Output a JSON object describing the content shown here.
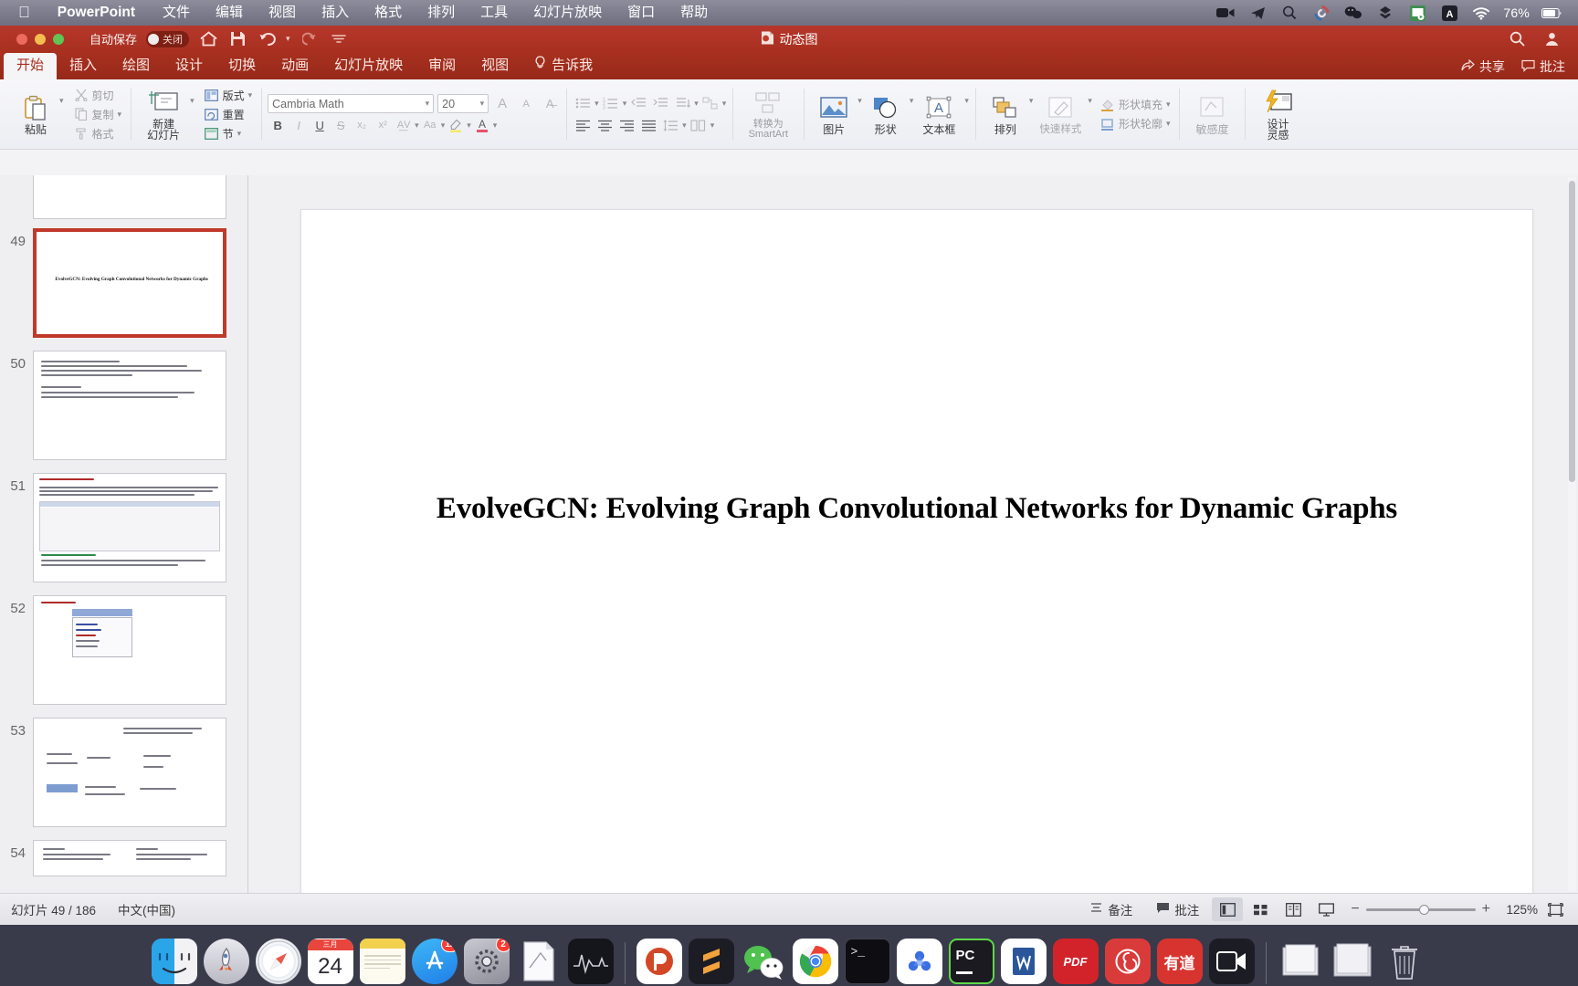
{
  "menubar": {
    "apple": "apple-logo",
    "app_name": "PowerPoint",
    "items": [
      "文件",
      "编辑",
      "视图",
      "插入",
      "格式",
      "排列",
      "工具",
      "幻灯片放映",
      "窗口",
      "帮助"
    ],
    "status_icons": [
      "camera-icon",
      "telegram-icon",
      "alfred-icon",
      "sync-icon",
      "wechat-icon",
      "dropbox-icon",
      "powerpoint-status-icon",
      "abc-input-icon"
    ],
    "wifi_icon": "wifi-icon",
    "battery_percent": "76%",
    "battery_icon": "battery-icon",
    "right_icons": [
      "clock-icon",
      "search-icon",
      "siri-icon",
      "control-center-icon"
    ]
  },
  "titlebar": {
    "autosave_label": "自动保存",
    "autosave_state": "关闭",
    "icons": [
      "home-icon",
      "save-icon",
      "undo-icon",
      "redo-icon",
      "customize-icon"
    ],
    "document_title": "动态图",
    "doc_icon": "powerpoint-doc-icon",
    "search_icon": "search-icon",
    "account_icon": "account-icon"
  },
  "ribbon": {
    "tabs": [
      {
        "label": "开始",
        "active": true
      },
      {
        "label": "插入",
        "active": false
      },
      {
        "label": "绘图",
        "active": false
      },
      {
        "label": "设计",
        "active": false
      },
      {
        "label": "切换",
        "active": false
      },
      {
        "label": "动画",
        "active": false
      },
      {
        "label": "幻灯片放映",
        "active": false
      },
      {
        "label": "审阅",
        "active": false
      },
      {
        "label": "视图",
        "active": false
      }
    ],
    "tellme_label": "告诉我",
    "share_label": "共享",
    "comments_label": "批注",
    "groups": {
      "clipboard": {
        "paste": "粘贴",
        "cut": "剪切",
        "copy": "复制",
        "format_painter": "格式"
      },
      "slides": {
        "new_slide": "新建\n幻灯片",
        "new_slide_line1": "新建",
        "new_slide_line2": "幻灯片",
        "layout": "版式",
        "reset": "重置",
        "section": "节"
      },
      "font": {
        "font_name": "Cambria Math",
        "font_size": "20",
        "grow_font": "A",
        "shrink_font": "A",
        "clear_formatting": "A",
        "bold": "B",
        "italic": "I",
        "underline": "U",
        "strikethrough": "S",
        "shadow": "S",
        "subscript": "x₂",
        "superscript": "x²",
        "char_spacing": "AV",
        "change_case": "Aa",
        "highlight": "highlight-icon",
        "font_color": "A"
      },
      "drawing": {
        "pictures": "图片",
        "shapes": "形状",
        "textbox": "文本框",
        "arrange": "排列",
        "quick_styles": "快速样式",
        "shape_fill": "形状填充",
        "shape_outline": "形状轮廓"
      },
      "sensitivity": {
        "label": "敏感度"
      },
      "designer": {
        "line1": "设计",
        "line2": "灵感"
      }
    }
  },
  "thumbnails": [
    {
      "number": "48",
      "selected": false,
      "kind": "blank",
      "title": ""
    },
    {
      "number": "49",
      "selected": true,
      "kind": "title",
      "title": "EvolveGCN: Evolving Graph Convolutional Networks for Dynamic Graphs"
    },
    {
      "number": "50",
      "selected": false,
      "kind": "text",
      "title": ""
    },
    {
      "number": "51",
      "selected": false,
      "kind": "table",
      "title": ""
    },
    {
      "number": "52",
      "selected": false,
      "kind": "small-table",
      "title": ""
    },
    {
      "number": "53",
      "selected": false,
      "kind": "diagram",
      "title": ""
    },
    {
      "number": "54",
      "selected": false,
      "kind": "two-col",
      "title": ""
    }
  ],
  "slide": {
    "title": "EvolveGCN: Evolving Graph Convolutional Networks for Dynamic Graphs"
  },
  "statusbar": {
    "slide_counter": "幻灯片 49 / 186",
    "language": "中文(中国)",
    "notes_label": "备注",
    "comments_label": "批注",
    "views": [
      "normal-view-icon",
      "slide-sorter-icon",
      "reading-view-icon",
      "slideshow-icon"
    ],
    "zoom_minus": "−",
    "zoom_plus": "+",
    "zoom_percent": "125%",
    "fit_icon": "fit-to-window-icon"
  },
  "dock": {
    "items": [
      {
        "name": "finder-icon",
        "label": "Finder",
        "badge": "",
        "running": true
      },
      {
        "name": "launchpad-icon",
        "label": "Launchpad",
        "badge": "",
        "running": false
      },
      {
        "name": "safari-icon",
        "label": "Safari",
        "badge": "",
        "running": false
      },
      {
        "name": "calendar-icon",
        "label": "Calendar",
        "badge": "",
        "day": "24",
        "month": "三月",
        "running": false
      },
      {
        "name": "notes-icon",
        "label": "Notes",
        "badge": "",
        "running": false
      },
      {
        "name": "app-store-icon",
        "label": "App Store",
        "badge": "12",
        "running": false
      },
      {
        "name": "system-preferences-icon",
        "label": "System Preferences",
        "badge": "2",
        "running": false
      },
      {
        "name": "preview-icon",
        "label": "Preview",
        "badge": "",
        "running": false
      },
      {
        "name": "activity-monitor-icon",
        "label": "Activity Monitor",
        "badge": "",
        "running": false
      },
      {
        "name": "powerpoint-icon",
        "label": "PowerPoint",
        "badge": "",
        "running": true
      },
      {
        "name": "sublime-text-icon",
        "label": "Sublime Text",
        "badge": "",
        "running": true
      },
      {
        "name": "wechat-icon",
        "label": "WeChat",
        "badge": "",
        "running": true
      },
      {
        "name": "chrome-icon",
        "label": "Google Chrome",
        "badge": "",
        "running": true
      },
      {
        "name": "terminal-icon",
        "label": "Terminal",
        "badge": "",
        "running": true
      },
      {
        "name": "baidu-netdisk-icon",
        "label": "Baidu Netdisk",
        "badge": "",
        "running": true
      },
      {
        "name": "pycharm-icon",
        "label": "PyCharm",
        "badge": "",
        "running": true
      },
      {
        "name": "word-icon",
        "label": "Word",
        "badge": "",
        "running": true
      },
      {
        "name": "pdf-reader-icon",
        "label": "PDF",
        "badge": "",
        "running": true
      },
      {
        "name": "netease-music-icon",
        "label": "NetEase Music",
        "badge": "",
        "running": true
      },
      {
        "name": "youdao-icon",
        "label": "有道",
        "badge": "",
        "running": true
      },
      {
        "name": "quicktime-icon",
        "label": "QuickTime",
        "badge": "",
        "running": true
      },
      {
        "name": "trash-icon",
        "label": "Trash",
        "badge": "",
        "running": false
      }
    ],
    "right_items": [
      {
        "name": "documents-stack-icon",
        "label": "Documents"
      },
      {
        "name": "downloads-stack-icon",
        "label": "Downloads"
      }
    ]
  }
}
